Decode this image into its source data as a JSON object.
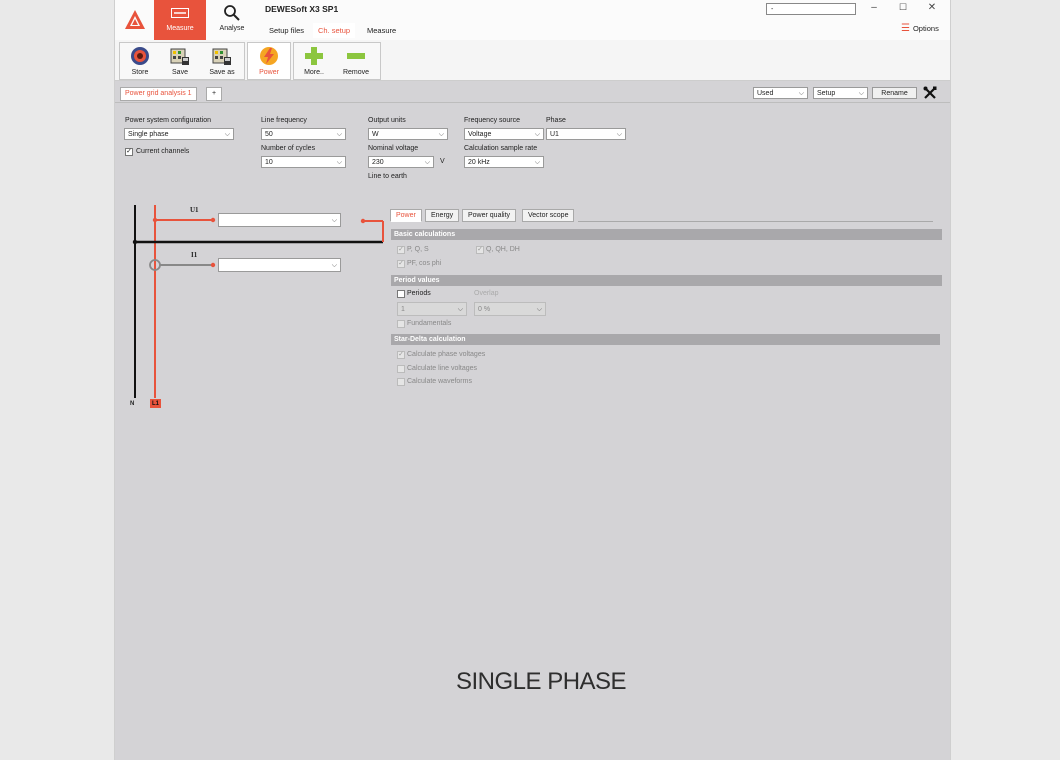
{
  "app": {
    "title": "DEWESoft X3 SP1",
    "modes": [
      {
        "label": "Measure",
        "active": true
      },
      {
        "label": "Analyse",
        "active": false
      }
    ],
    "menu_tabs": [
      "Setup files",
      "Ch. setup",
      "Measure"
    ],
    "active_menu_tab": "Ch. setup",
    "window_field_value": "-",
    "options_label": "Options",
    "accent_color": "#e8533c"
  },
  "ribbon": {
    "buttons": [
      {
        "label": "Store",
        "icon": "store-icon"
      },
      {
        "label": "Save",
        "icon": "save-icon"
      },
      {
        "label": "Save as",
        "icon": "save-as-icon"
      },
      {
        "label": "Power",
        "icon": "power-icon",
        "active": true
      },
      {
        "label": "More..",
        "icon": "plus-icon"
      },
      {
        "label": "Remove",
        "icon": "minus-icon"
      }
    ]
  },
  "setup_tabs": {
    "tabs": [
      "Power grid analysis 1",
      "+"
    ],
    "used_select": "Used",
    "setup_select": "Setup",
    "rename_label": "Rename"
  },
  "config": {
    "power_system_label": "Power system configuration",
    "power_system_value": "Single phase",
    "current_channels_label": "Current channels",
    "current_channels_checked": true,
    "line_frequency_label": "Line frequency",
    "line_frequency_value": "50",
    "cycles_label": "Number of cycles",
    "cycles_value": "10",
    "output_units_label": "Output units",
    "output_units_value": "W",
    "nominal_voltage_label": "Nominal voltage",
    "nominal_voltage_value": "230",
    "nominal_voltage_unit": "V",
    "line_to_earth_label": "Line to earth",
    "frequency_source_label": "Frequency source",
    "frequency_source_value": "Voltage",
    "sample_rate_label": "Calculation sample rate",
    "sample_rate_value": "20 kHz",
    "phase_label": "Phase",
    "phase_value": "U1"
  },
  "wiring": {
    "u1_label": "U1",
    "i1_label": "I1",
    "n_label": "N",
    "l1_label": "L1"
  },
  "calc_tabs": [
    "Power",
    "Energy",
    "Power quality",
    "Vector scope"
  ],
  "calc": {
    "basic_header": "Basic calculations",
    "pqs_label": "P, Q, S",
    "qqhdh_label": "Q, QH, DH",
    "pf_label": "PF, cos phi",
    "period_header": "Period values",
    "periods_label": "Periods",
    "overlap_label": "Overlap",
    "periods_value": "1",
    "overlap_value": "0 %",
    "fundamentals_label": "Fundamentals",
    "star_delta_header": "Star-Delta calculation",
    "phase_voltages_label": "Calculate phase voltages",
    "line_voltages_label": "Calculate line voltages",
    "waveforms_label": "Calculate waveforms"
  },
  "footer_caption": "SINGLE PHASE"
}
